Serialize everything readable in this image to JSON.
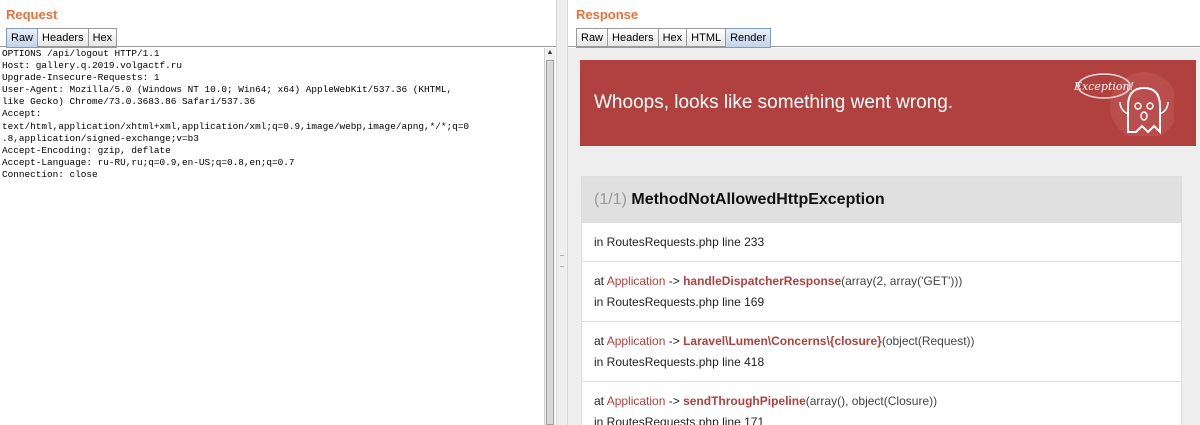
{
  "request": {
    "title": "Request",
    "tabs": [
      "Raw",
      "Headers",
      "Hex"
    ],
    "active_tab": "Raw",
    "raw_lines": [
      "OPTIONS /api/logout HTTP/1.1",
      "Host: gallery.q.2019.volgactf.ru",
      "Upgrade-Insecure-Requests: 1",
      "User-Agent: Mozilla/5.0 (Windows NT 10.0; Win64; x64) AppleWebKit/537.36 (KHTML,",
      "like Gecko) Chrome/73.0.3683.86 Safari/537.36",
      "Accept:",
      "text/html,application/xhtml+xml,application/xml;q=0.9,image/webp,image/apng,*/*;q=0",
      ".8,application/signed-exchange;v=b3",
      "Accept-Encoding: gzip, deflate",
      "Accept-Language: ru-RU,ru;q=0.9,en-US;q=0.8,en;q=0.7",
      "Connection: close"
    ]
  },
  "response": {
    "title": "Response",
    "tabs": [
      "Raw",
      "Headers",
      "Hex",
      "HTML",
      "Render"
    ],
    "active_tab": "Render",
    "render": {
      "banner_message": "Whoops, looks like something went wrong.",
      "banner_badge": "Exception!",
      "exception_count": "(1/1)",
      "exception_name": "MethodNotAllowedHttpException",
      "frames": [
        {
          "location": "in RoutesRequests.php line 233"
        },
        {
          "at": "at ",
          "cls": "Application",
          "arrow": " -> ",
          "fn": "handleDispatcherResponse",
          "args": "(array(2, array('GET')))",
          "location": "in RoutesRequests.php line 169"
        },
        {
          "at": "at ",
          "cls": "Application",
          "arrow": " -> ",
          "fn": "Laravel\\Lumen\\Concerns\\{closure}",
          "args": "(object(Request))",
          "location": "in RoutesRequests.php line 418"
        },
        {
          "at": "at ",
          "cls": "Application",
          "arrow": " -> ",
          "fn": "sendThroughPipeline",
          "args": "(array(), object(Closure))",
          "location": "in RoutesRequests.php line 171"
        }
      ]
    }
  },
  "colors": {
    "pane_title": "#e8703a",
    "banner": "#b0413e",
    "class_link": "#b0413e"
  }
}
